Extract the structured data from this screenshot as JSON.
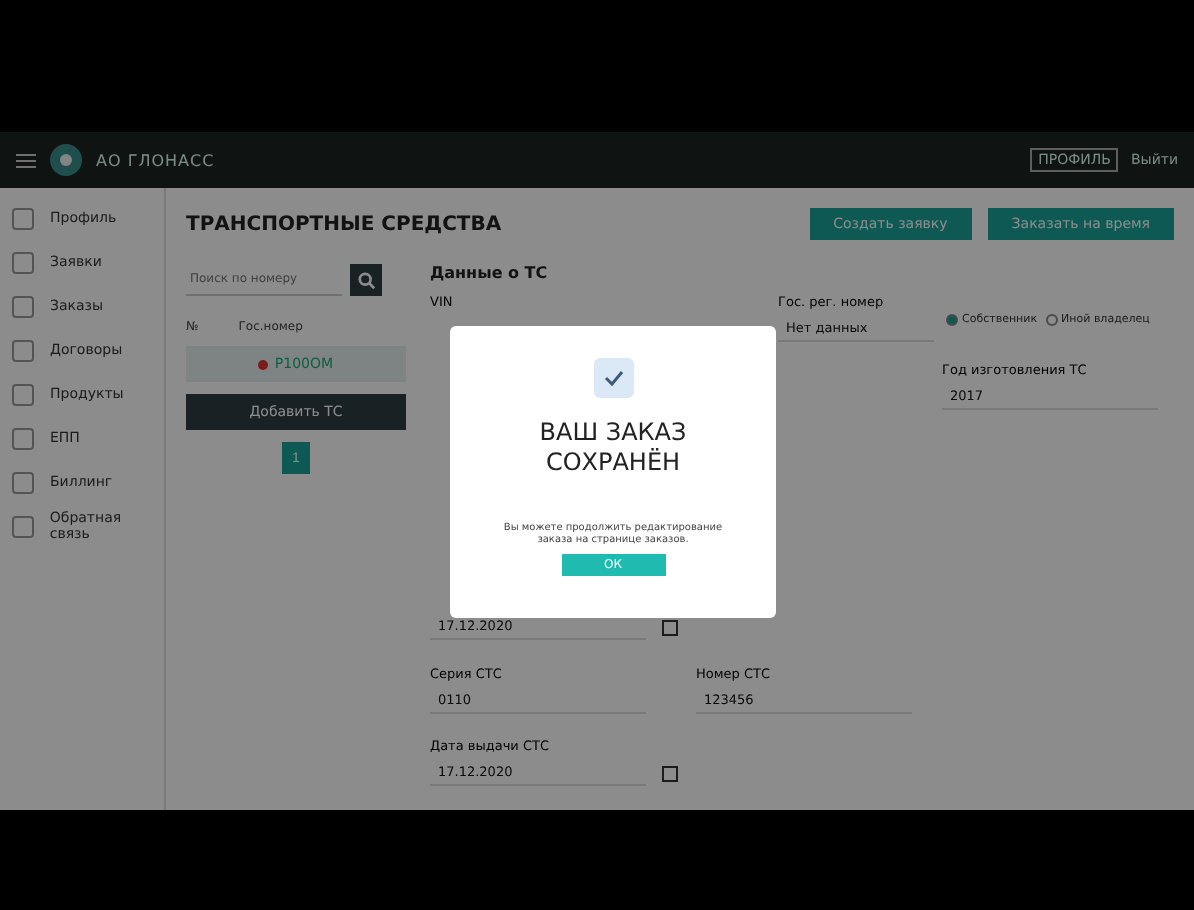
{
  "header": {
    "brand": "АО ГЛОНАСС",
    "user": "ПРОФИЛЬ",
    "logout": "Выйти"
  },
  "sidebar": {
    "items": [
      {
        "label": "Профиль",
        "selected": false
      },
      {
        "label": "Заявки",
        "selected": false
      },
      {
        "label": "Заказы",
        "selected": false
      },
      {
        "label": "Договоры",
        "selected": false
      },
      {
        "label": "Продукты",
        "selected": false
      },
      {
        "label": "ЕПП",
        "selected": false
      },
      {
        "label": "Биллинг",
        "selected": false
      },
      {
        "label": "Обратная связь",
        "selected": false
      }
    ]
  },
  "page": {
    "title": "ТРАНСПОРТНЫЕ СРЕДСТВА",
    "actions": [
      "Создать заявку",
      "Заказать на время"
    ]
  },
  "vehicle_list": {
    "search_placeholder": "Поиск по номеру",
    "columns": [
      "№",
      "Гос.номер"
    ],
    "rows": [
      {
        "plate": "Р100ОМ",
        "selected": true
      }
    ],
    "add_button": "Добавить ТС",
    "pages": [
      {
        "label": "1",
        "selected": true
      }
    ]
  },
  "form": {
    "title": "Данные о ТС",
    "rows": [
      {
        "left": {
          "label": "VIN"
        },
        "middle": {
          "label": "Гос. рег. номер",
          "value": "Нет данных"
        },
        "right": {
          "kind": "radio",
          "options": [
            {
              "label": "Собственник",
              "selected": true
            },
            {
              "label": "Иной владелец",
              "selected": false
            }
          ]
        }
      },
      {
        "right": {
          "label": "Год изготовления ТС",
          "value": "2017"
        }
      },
      {
        "left": {
          "kind": "date",
          "value": "17.12.2020"
        }
      },
      {
        "left": {
          "label": "Серия СТС",
          "value": "0110"
        },
        "middle": {
          "label": "Номер СТС",
          "value": "123456"
        }
      },
      {
        "left": {
          "kind": "date",
          "label": "Дата выдачи СТС",
          "value": "17.12.2020"
        }
      }
    ]
  },
  "modal": {
    "title": "ВАШ ЗАКАЗ СОХРАНЁН",
    "message": "Вы можете продолжить редактирование заказа на странице заказов.",
    "button": "ОК"
  }
}
